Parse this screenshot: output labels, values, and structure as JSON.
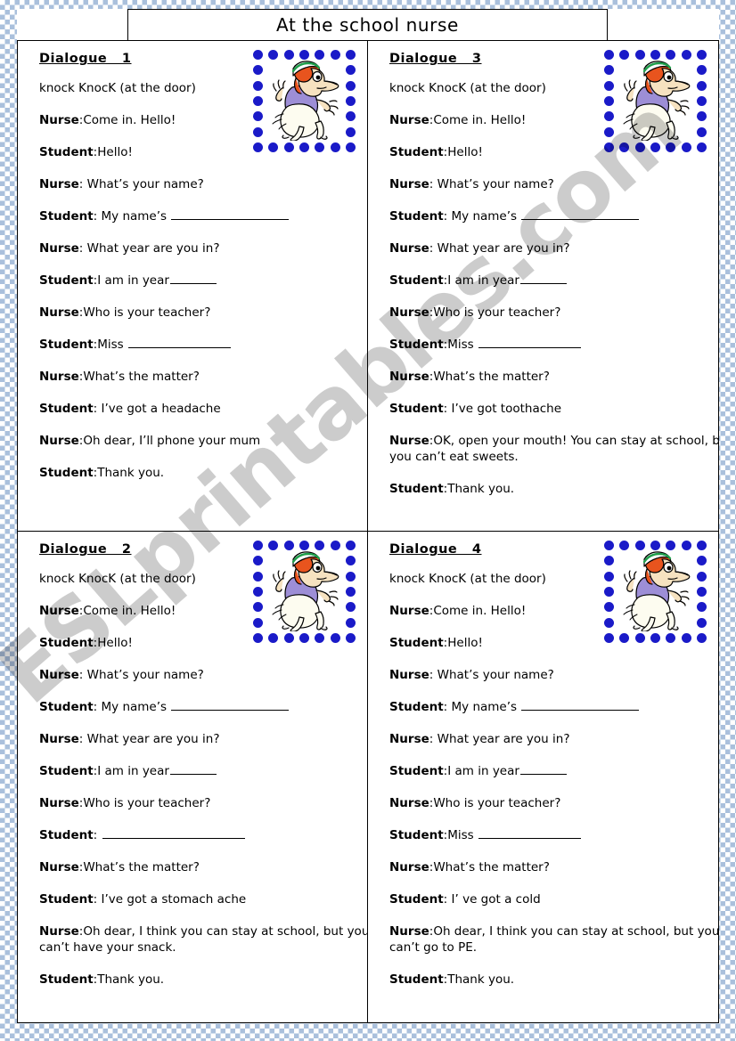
{
  "title": "At the school nurse",
  "watermark": "ESLprintables.com",
  "colors": {
    "border_check": "#aac0dc",
    "dot_blue": "#1a1ac8",
    "text": "#000000",
    "hair": "#e8541e",
    "uniform": "#9d8ed6",
    "cap_stripe": "#1e9e4a"
  },
  "clipart": {
    "name": "running-school-nurse-cartoon",
    "alt": "Cartoon nurse with red hair, green-striped cap and purple uniform running"
  },
  "dialogues": [
    {
      "id": "dialogue-1",
      "heading": "Dialogue   1",
      "lines": [
        {
          "speaker": "",
          "text": "knock KnocK (at the door)"
        },
        {
          "speaker": "Nurse",
          "sep": ":",
          "text": "Come in.  Hello!"
        },
        {
          "speaker": "Student",
          "sep": ":",
          "text": "Hello!"
        },
        {
          "speaker": "Nurse",
          "sep": ":",
          "text": " What’s your name?"
        },
        {
          "speaker": "Student",
          "sep": ":",
          "text": " My name’s ",
          "blank": "long"
        },
        {
          "speaker": "Nurse",
          "sep": ":",
          "text": " What year are you in?"
        },
        {
          "speaker": "Student",
          "sep": ":",
          "text": "I am in year",
          "blank": "short"
        },
        {
          "speaker": "Nurse",
          "sep": ":",
          "text": "Who is your teacher?"
        },
        {
          "speaker": "Student",
          "sep": ":",
          "text": "Miss ",
          "blank": "med"
        },
        {
          "speaker": "Nurse",
          "sep": ":",
          "text": "What’s the matter?"
        },
        {
          "speaker": "Student",
          "sep": ":",
          "text": " I’ve got a headache"
        },
        {
          "speaker": "Nurse",
          "sep": ":",
          "text": "Oh dear, I’ll phone your mum"
        },
        {
          "speaker": "Student",
          "sep": ":",
          "text": "Thank you."
        }
      ]
    },
    {
      "id": "dialogue-3",
      "heading": "Dialogue   3",
      "lines": [
        {
          "speaker": "",
          "text": "knock KnocK (at the door)"
        },
        {
          "speaker": "Nurse",
          "sep": ":",
          "text": "Come in.  Hello!"
        },
        {
          "speaker": "Student",
          "sep": ":",
          "text": "Hello!"
        },
        {
          "speaker": "Nurse",
          "sep": ":",
          "text": " What’s your name?"
        },
        {
          "speaker": "Student",
          "sep": ":",
          "text": " My name’s ",
          "blank": "long"
        },
        {
          "speaker": "Nurse",
          "sep": ":",
          "text": " What year are you in?"
        },
        {
          "speaker": "Student",
          "sep": ":",
          "text": "I am in year",
          "blank": "short"
        },
        {
          "speaker": "Nurse",
          "sep": ":",
          "text": "Who is your teacher?"
        },
        {
          "speaker": "Student",
          "sep": ":",
          "text": "Miss ",
          "blank": "med"
        },
        {
          "speaker": "Nurse",
          "sep": ":",
          "text": "What’s the matter?"
        },
        {
          "speaker": "Student",
          "sep": ":",
          "text": " I’ve got toothache"
        },
        {
          "speaker": "Nurse",
          "sep": ":",
          "text": "OK, open your mouth! You can stay at school, but you can’t eat sweets."
        },
        {
          "speaker": "Student",
          "sep": ":",
          "text": "Thank you."
        }
      ]
    },
    {
      "id": "dialogue-2",
      "heading": "Dialogue   2",
      "lines": [
        {
          "speaker": "",
          "text": "knock KnocK (at the door)"
        },
        {
          "speaker": "Nurse",
          "sep": ":",
          "text": "Come in.  Hello!"
        },
        {
          "speaker": "Student",
          "sep": ":",
          "text": "Hello!"
        },
        {
          "speaker": "Nurse",
          "sep": ":",
          "text": " What’s your name?"
        },
        {
          "speaker": "Student",
          "sep": ":",
          "text": " My name’s ",
          "blank": "long"
        },
        {
          "speaker": "Nurse",
          "sep": ":",
          "text": " What year are you in?"
        },
        {
          "speaker": "Student",
          "sep": ":",
          "text": "I am in year",
          "blank": "short"
        },
        {
          "speaker": "Nurse",
          "sep": ":",
          "text": "Who is your teacher?"
        },
        {
          "speaker": "Student",
          "sep": ":",
          "text": " ",
          "blank": "xlong"
        },
        {
          "speaker": "Nurse",
          "sep": ":",
          "text": "What’s the matter?"
        },
        {
          "speaker": "Student",
          "sep": ":",
          "text": " I’ve got a stomach ache"
        },
        {
          "speaker": "Nurse",
          "sep": ":",
          "text": "Oh dear, I think you can stay at school, but you can’t have your snack."
        },
        {
          "speaker": "Student",
          "sep": ":",
          "text": "Thank you."
        }
      ]
    },
    {
      "id": "dialogue-4",
      "heading": "Dialogue   4",
      "lines": [
        {
          "speaker": "",
          "text": "knock KnocK (at the door)"
        },
        {
          "speaker": "Nurse",
          "sep": ":",
          "text": "Come in.  Hello!"
        },
        {
          "speaker": "Student",
          "sep": ":",
          "text": "Hello!"
        },
        {
          "speaker": "Nurse",
          "sep": ":",
          "text": " What’s your name?"
        },
        {
          "speaker": "Student",
          "sep": ":",
          "text": " My name’s ",
          "blank": "long"
        },
        {
          "speaker": "Nurse",
          "sep": ":",
          "text": " What year are you in?"
        },
        {
          "speaker": "Student",
          "sep": ":",
          "text": "I am in year",
          "blank": "short"
        },
        {
          "speaker": "Nurse",
          "sep": ":",
          "text": "Who is your teacher?"
        },
        {
          "speaker": "Student",
          "sep": ":",
          "text": "Miss ",
          "blank": "med"
        },
        {
          "speaker": "Nurse",
          "sep": ":",
          "text": "What’s the matter?"
        },
        {
          "speaker": "Student",
          "sep": ":",
          "text": " I’ ve got a cold"
        },
        {
          "speaker": "Nurse",
          "sep": ":",
          "text": "Oh dear, I think you can stay at school, but you can’t go to PE."
        },
        {
          "speaker": "Student",
          "sep": ":",
          "text": "Thank you."
        }
      ]
    }
  ]
}
